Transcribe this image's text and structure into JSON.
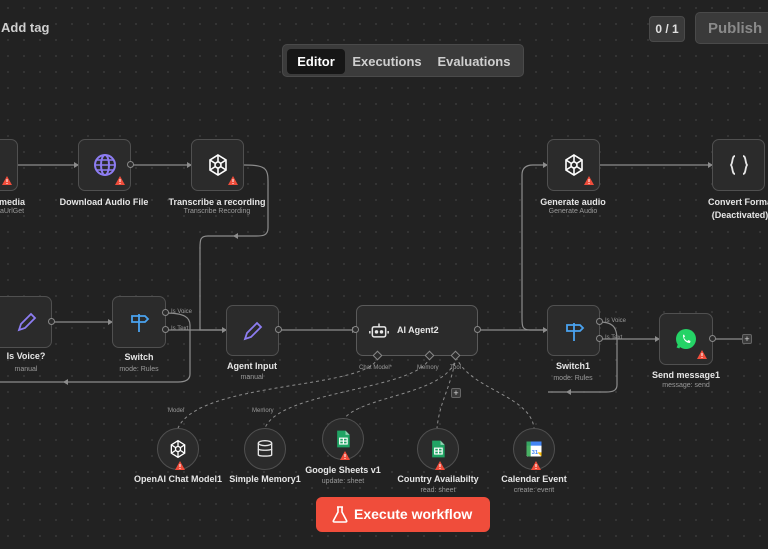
{
  "header": {
    "add_tag": "Add tag",
    "counter": "0 / 1",
    "publish": "Publish"
  },
  "tabs": [
    "Editor",
    "Executions",
    "Evaluations"
  ],
  "active_tab": "Editor",
  "nodes": {
    "media": {
      "label": "media",
      "sub": "aUrlGet"
    },
    "download": {
      "label": "Download Audio File"
    },
    "transcribe": {
      "label": "Transcribe a recording",
      "sub": "Transcribe Recording"
    },
    "generate": {
      "label": "Generate audio",
      "sub": "Generate Audio"
    },
    "convert": {
      "label": "Convert Forma",
      "sub": "(Deactivated)"
    },
    "isvoice": {
      "label": "Is Voice?",
      "sub": "manual"
    },
    "switch": {
      "label": "Switch",
      "sub": "mode: Rules",
      "out1": "Is Voice",
      "out2": "Is Text"
    },
    "agentinput": {
      "label": "Agent Input",
      "sub": "manual"
    },
    "aiagent": {
      "label": "AI Agent2",
      "port_chat": "Chat Model*",
      "port_memory": "Memory",
      "port_tool": "Tool"
    },
    "switch1": {
      "label": "Switch1",
      "sub": "mode: Rules",
      "out1": "Is Voice",
      "out2": "Is Text"
    },
    "send": {
      "label": "Send message1",
      "sub": "message: send"
    }
  },
  "subnodes": {
    "openai": {
      "label": "OpenAI Chat Model1",
      "tag": "Model"
    },
    "memory": {
      "label": "Simple Memory1",
      "tag": "Memory"
    },
    "sheets": {
      "label": "Google Sheets v1",
      "sub": "update: sheet"
    },
    "country": {
      "label": "Country Availabilty",
      "sub": "read: sheet"
    },
    "calendar": {
      "label": "Calendar Event",
      "sub": "create: event"
    }
  },
  "execute": "Execute workflow",
  "colors": {
    "accent": "#f04d3b",
    "warning": "#f04d3b",
    "background": "#222222"
  },
  "icons": [
    "globe-icon",
    "openai-icon",
    "braces-icon",
    "pencil-icon",
    "signpost-icon",
    "robot-icon",
    "whatsapp-icon",
    "database-icon",
    "sheets-icon",
    "calendar-icon",
    "flask-icon",
    "warning-icon"
  ]
}
